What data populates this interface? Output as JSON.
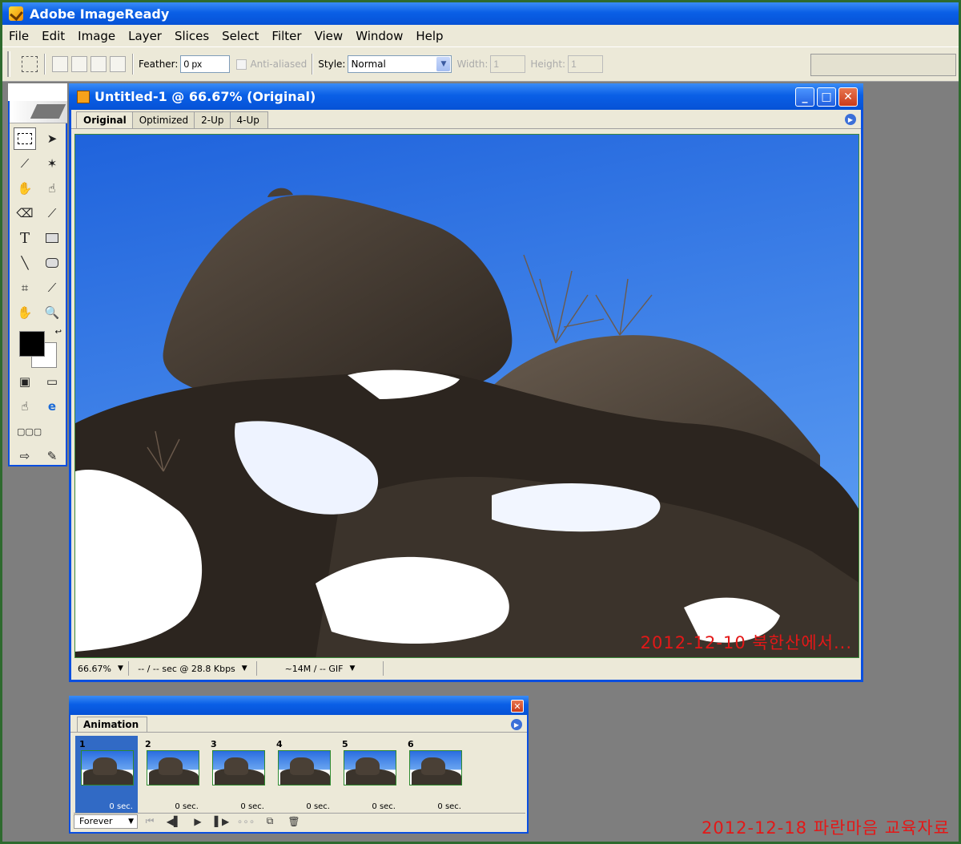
{
  "app": {
    "title": "Adobe ImageReady"
  },
  "menu": [
    "File",
    "Edit",
    "Image",
    "Layer",
    "Slices",
    "Select",
    "Filter",
    "View",
    "Window",
    "Help"
  ],
  "options": {
    "feather_label": "Feather:",
    "feather_value": "0 px",
    "antialias_label": "Anti-aliased",
    "style_label": "Style:",
    "style_value": "Normal",
    "width_label": "Width:",
    "width_value": "1",
    "height_label": "Height:",
    "height_value": "1"
  },
  "document": {
    "title": "Untitled-1 @ 66.67% (Original)",
    "tabs": [
      "Original",
      "Optimized",
      "2-Up",
      "4-Up"
    ],
    "active_tab": "Original",
    "photo_caption": "2012-12-10 북한산에서...",
    "status": {
      "zoom": "66.67%",
      "speed": "-- / -- sec @ 28.8 Kbps",
      "size": "~14M / -- GIF"
    }
  },
  "animation": {
    "tab": "Animation",
    "frames": [
      {
        "num": "1",
        "delay": "0 sec."
      },
      {
        "num": "2",
        "delay": "0 sec."
      },
      {
        "num": "3",
        "delay": "0 sec."
      },
      {
        "num": "4",
        "delay": "0 sec."
      },
      {
        "num": "5",
        "delay": "0 sec."
      },
      {
        "num": "6",
        "delay": "0 sec."
      }
    ],
    "selected_frame": "1",
    "loop": "Forever"
  },
  "footer": {
    "caption": "2012-12-18 파란마음 교육자료"
  },
  "colors": {
    "titlebar": "#0a5fe6",
    "caption_red": "#e31818",
    "background": "#7e7e7e",
    "foreground_swatch": "#000000",
    "background_swatch": "#ffffff"
  }
}
